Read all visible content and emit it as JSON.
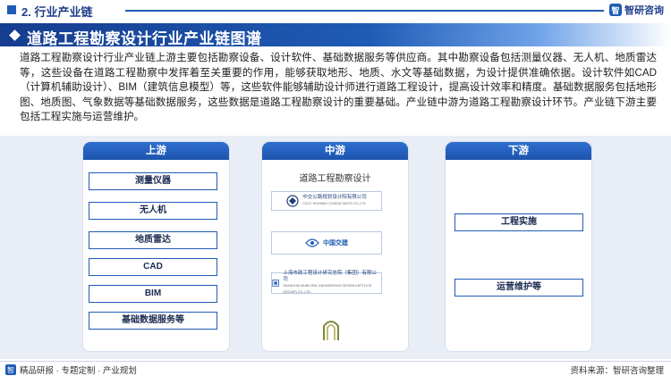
{
  "section": {
    "title": "2. 行业产业链"
  },
  "brand": {
    "name": "智研咨询",
    "logo_glyph": "智"
  },
  "banner": {
    "title": "道路工程勘察设计行业产业链图谱"
  },
  "description": "道路工程勘察设计行业产业链上游主要包括勘察设备、设计软件、基础数据服务等供应商。其中勘察设备包括测量仪器、无人机、地质雷达等，这些设备在道路工程勘察中发挥着至关重要的作用，能够获取地形、地质、水文等基础数据，为设计提供准确依据。设计软件如CAD（计算机辅助设计）、BIM（建筑信息模型）等，这些软件能够辅助设计师进行道路工程设计，提高设计效率和精度。基础数据服务包括地形图、地质图、气象数据等基础数据服务，这些数据是道路工程勘察设计的重要基础。产业链中游为道路工程勘察设计环节。产业链下游主要包括工程实施与运营维护。",
  "upstream": {
    "label": "上游",
    "items": [
      "测量仪器",
      "无人机",
      "地质雷达",
      "CAD",
      "BIM",
      "基础数据服务等"
    ]
  },
  "midstream": {
    "label": "中游",
    "subtitle": "道路工程勘察设计",
    "companies": [
      {
        "name": "中交公路规划设计院有限公司",
        "sub": "CCCC HIGHWAY CONSULTANTS CO.,LTD."
      },
      {
        "name": "中国交建",
        "sub": ""
      },
      {
        "name": "上海市政工程设计研究总院（集团）有限公司",
        "sub": "SHANGHAI MUNICIPAL ENGINEERING DESIGN INSTITUTE (GROUP) CO.,LTD."
      }
    ]
  },
  "downstream": {
    "label": "下游",
    "items": [
      "工程实施",
      "运营维护等"
    ]
  },
  "footer": {
    "left": "精品研报 · 专题定制 · 产业规划",
    "right": "资料来源：智研咨询整理"
  },
  "watermark": "智研咨询",
  "colors": {
    "primary": "#1f5bb5",
    "dark": "#163d8f",
    "panel_bg": "#e9eef6"
  }
}
